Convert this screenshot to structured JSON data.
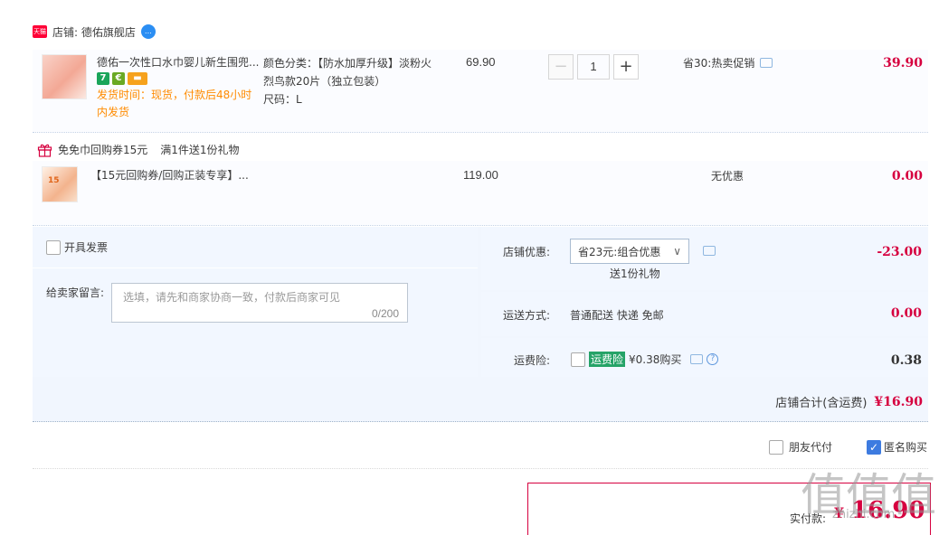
{
  "shop": {
    "badge": "天猫",
    "label": "店铺: 德佑旗舰店",
    "chat_badge": "…"
  },
  "item1": {
    "title": "德佑一次性口水巾婴儿新生围兜...",
    "badges": [
      "7",
      "€",
      "▬"
    ],
    "ship_info": "发货时间：现货，付款后48小时内发货",
    "spec_color": "颜色分类：【防水加厚升级】淡粉火烈鸟款20片（独立包装）",
    "spec_size": "尺码：L",
    "price": "69.90",
    "quantity": "1",
    "qty_minus": "−",
    "qty_plus": "+",
    "promo": "省30:热卖促销",
    "subtotal": "39.90"
  },
  "gift_header": {
    "label": "免免巾回购券15元",
    "rule": "满1件送1份礼物"
  },
  "item2": {
    "thumb_text": "15",
    "title": "【15元回购券/回购正装专享】...",
    "price": "119.00",
    "promo": "无优惠",
    "subtotal": "0.00"
  },
  "invoice": {
    "label": "开具发票",
    "checked": false
  },
  "message": {
    "label": "给卖家留言:",
    "placeholder": "选填，请先和商家协商一致，付款后商家可见",
    "counter": "0/200"
  },
  "shop_discount": {
    "label": "店铺优惠:",
    "selected": "省23元:组合优惠",
    "caret": "∨",
    "note": "送1份礼物",
    "amount": "-23.00"
  },
  "shipping": {
    "label": "运送方式:",
    "value": "普通配送 快递 免邮",
    "amount": "0.00"
  },
  "insurance": {
    "label": "运费险:",
    "tag": "运费险",
    "value": "¥0.38购买",
    "help": "?",
    "amount": "0.38",
    "checked": false
  },
  "shop_total": {
    "label": "店铺合计(含运费)",
    "amount": "¥16.90"
  },
  "options": {
    "friend_pay": "朋友代付",
    "anonymous": "匿名购买"
  },
  "payment": {
    "label": "实付款:",
    "currency": "¥",
    "amount": "16.90"
  },
  "watermark": {
    "big": "值值值",
    "small": "zhizhi.com"
  }
}
